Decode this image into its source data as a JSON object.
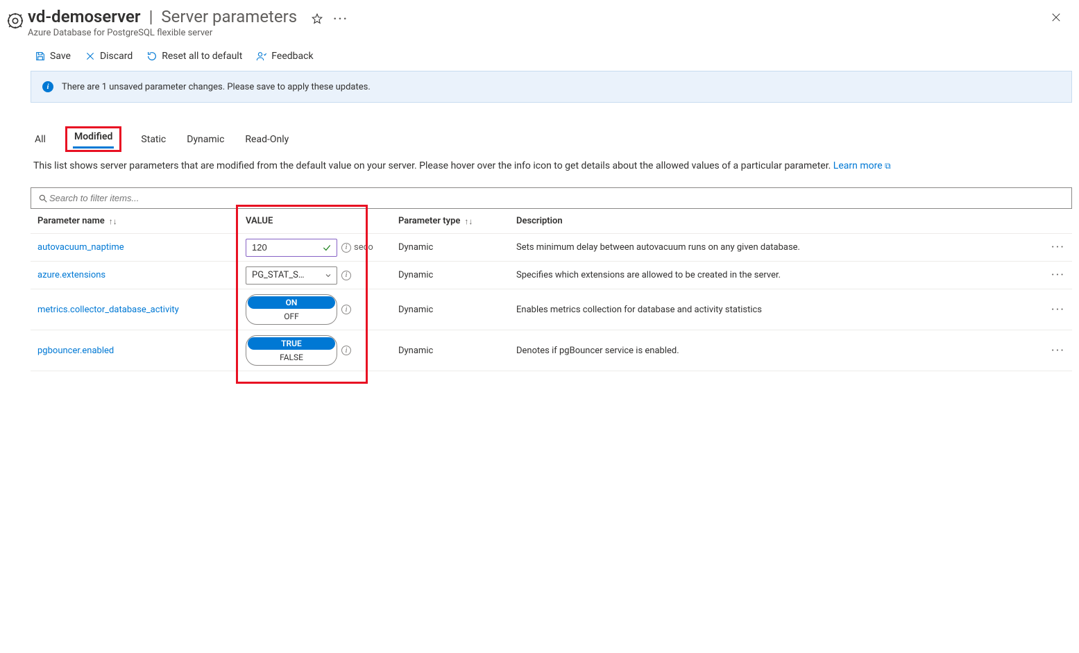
{
  "header": {
    "resource_name": "vd-demoserver",
    "page_title": "Server parameters",
    "subtitle": "Azure Database for PostgreSQL flexible server"
  },
  "toolbar": {
    "save": "Save",
    "discard": "Discard",
    "reset": "Reset all to default",
    "feedback": "Feedback"
  },
  "banner": {
    "text": "There are 1 unsaved parameter changes.  Please save to apply these updates."
  },
  "tabs": {
    "all": "All",
    "modified": "Modified",
    "static": "Static",
    "dynamic": "Dynamic",
    "readonly": "Read-Only"
  },
  "helptext": {
    "body": "This list shows server parameters that are modified from the default value on your server. Please hover over the info icon to get details about the allowed values of a particular parameter. ",
    "link": "Learn more"
  },
  "search": {
    "placeholder": "Search to filter items..."
  },
  "columns": {
    "name": "Parameter name",
    "value": "VALUE",
    "type": "Parameter type",
    "desc": "Description"
  },
  "rows": [
    {
      "name": "autovacuum_naptime",
      "value_kind": "text",
      "value": "120",
      "unit_fragment": "seco",
      "type": "Dynamic",
      "desc": "Sets minimum delay between autovacuum runs on any given database."
    },
    {
      "name": "azure.extensions",
      "value_kind": "dropdown",
      "value": "PG_STAT_S…",
      "type": "Dynamic",
      "desc": "Specifies which extensions are allowed to be created in the server."
    },
    {
      "name": "metrics.collector_database_activity",
      "value_kind": "toggle",
      "opt_true": "ON",
      "opt_false": "OFF",
      "type": "Dynamic",
      "desc": "Enables metrics collection for database and activity statistics"
    },
    {
      "name": "pgbouncer.enabled",
      "value_kind": "toggle",
      "opt_true": "TRUE",
      "opt_false": "FALSE",
      "type": "Dynamic",
      "desc": "Denotes if pgBouncer service is enabled."
    }
  ]
}
